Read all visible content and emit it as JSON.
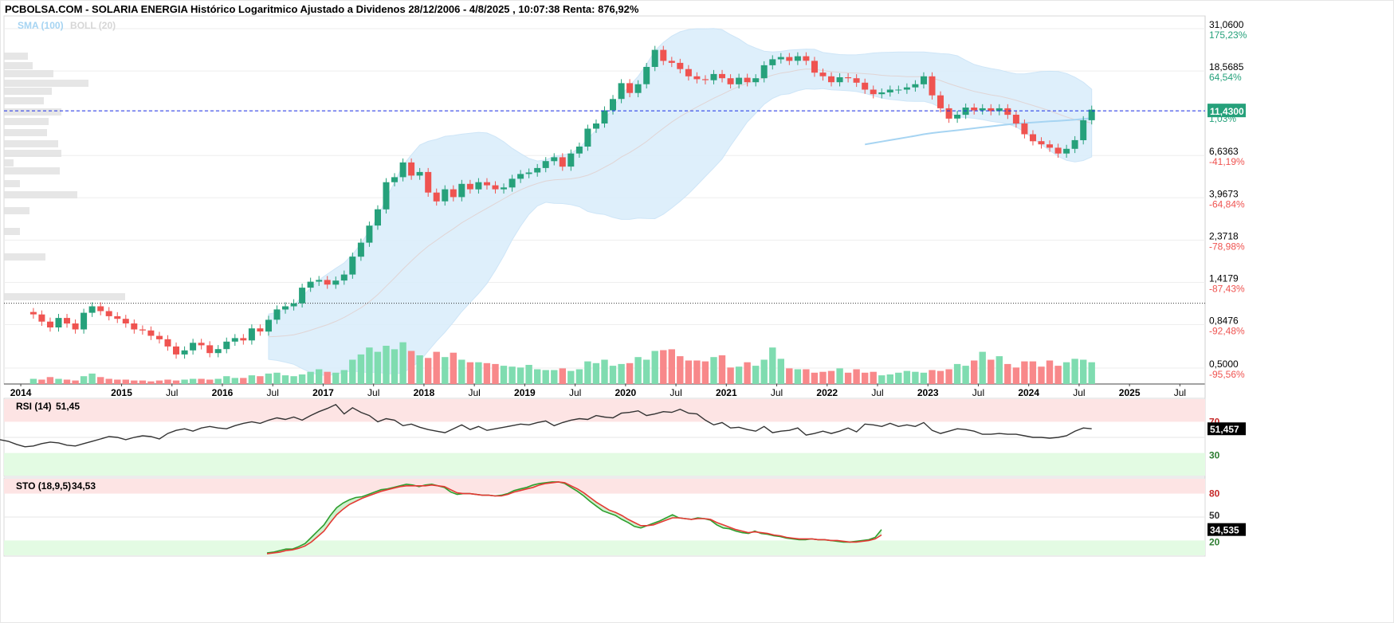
{
  "header": {
    "title": "PCBOLSA.COM - SOLARIA ENERGIA Histórico Logaritmico Ajustado a Dividenos 28/12/2006 - 4/8/2025 , 10:07:38 Renta: 876,92%",
    "legend_sma": "SMA (100)",
    "legend_boll": "BOLL (20)"
  },
  "colors": {
    "up": "#26a17b",
    "down": "#ef5350",
    "up_volume": "#7fdcb0",
    "down_volume": "#f8888a",
    "bollinger_fill": "#dbeefb",
    "sma": "#a6d4f2",
    "current_line": "#1a2ee6",
    "rsi_line": "#333333",
    "sto_k": "#2e9e2e",
    "sto_d": "#e53935",
    "overbought_band": "#fde4e4",
    "oversold_band": "#e3fbe3",
    "badge": "#26a17b",
    "badge_dark": "#000000"
  },
  "chart_data": [
    {
      "type": "candlestick",
      "name": "price",
      "scale": "log",
      "ylim": [
        0.42,
        35
      ],
      "xlim": [
        "2013-11",
        "2025-10"
      ],
      "x_ticks": [
        "2014",
        "2015",
        "Jul",
        "2016",
        "Jul",
        "2017",
        "Jul",
        "2018",
        "Jul",
        "2019",
        "Jul",
        "2020",
        "Jul",
        "2021",
        "Jul",
        "2022",
        "Jul",
        "2023",
        "Jul",
        "2024",
        "Jul",
        "2025",
        "Jul"
      ],
      "y_ticks": [
        {
          "price": "31,0600",
          "pct": "175,23%",
          "value": 31.06
        },
        {
          "price": "18,5685",
          "pct": "64,54%",
          "value": 18.5685
        },
        {
          "price": "11,4300",
          "pct": "1,03%",
          "value": 11.43
        },
        {
          "price": "6,6363",
          "pct": "-41,19%",
          "value": 6.6363
        },
        {
          "price": "3,9673",
          "pct": "-64,84%",
          "value": 3.9673
        },
        {
          "price": "2,3718",
          "pct": "-78,98%",
          "value": 2.3718
        },
        {
          "price": "1,4179",
          "pct": "-87,43%",
          "value": 1.4179
        },
        {
          "price": "0,8476",
          "pct": "-92,48%",
          "value": 0.8476
        },
        {
          "price": "0,5000",
          "pct": "-95,56%",
          "value": 0.5
        }
      ],
      "current_price": "11,4300",
      "reference_line": 1.1,
      "candles_start": "2014-02",
      "closes": [
        0.96,
        0.88,
        0.82,
        0.92,
        0.86,
        0.8,
        0.98,
        1.06,
        1.0,
        0.94,
        0.91,
        0.86,
        0.8,
        0.79,
        0.74,
        0.71,
        0.65,
        0.59,
        0.62,
        0.68,
        0.66,
        0.6,
        0.63,
        0.69,
        0.72,
        0.7,
        0.81,
        0.78,
        0.9,
        1.02,
        1.06,
        1.1,
        1.33,
        1.43,
        1.46,
        1.38,
        1.45,
        1.56,
        1.94,
        2.3,
        2.83,
        3.45,
        4.8,
        5.1,
        6.1,
        5.2,
        5.43,
        4.23,
        3.8,
        4.4,
        4.0,
        4.7,
        4.4,
        4.8,
        4.62,
        4.4,
        4.5,
        5.0,
        5.3,
        5.4,
        5.7,
        6.2,
        6.5,
        5.8,
        6.8,
        7.4,
        9.2,
        9.8,
        11.5,
        13.2,
        16.0,
        14.2,
        15.8,
        19.5,
        24.0,
        21.0,
        20.5,
        19.0,
        17.4,
        16.8,
        16.6,
        17.9,
        17.0,
        15.8,
        17.1,
        16.2,
        17.0,
        19.9,
        21.4,
        22.0,
        21.0,
        22.2,
        21.0,
        18.2,
        17.4,
        16.2,
        17.2,
        17.0,
        16.1,
        14.8,
        14.0,
        14.3,
        14.8,
        14.8,
        15.2,
        15.8,
        17.4,
        13.8,
        11.8,
        10.4,
        10.9,
        11.9,
        11.5,
        11.8,
        11.4,
        11.8,
        10.9,
        9.8,
        8.6,
        7.9,
        7.6,
        7.3,
        6.8,
        7.2,
        8.0,
        10.2,
        11.6
      ],
      "volumes": [
        6,
        5,
        8,
        6,
        5,
        4,
        9,
        12,
        8,
        6,
        5,
        5,
        4,
        4,
        3,
        4,
        5,
        4,
        5,
        6,
        6,
        5,
        6,
        9,
        7,
        7,
        10,
        9,
        12,
        13,
        10,
        9,
        11,
        14,
        17,
        14,
        13,
        16,
        28,
        34,
        42,
        37,
        44,
        40,
        48,
        38,
        33,
        30,
        37,
        31,
        36,
        28,
        25,
        25,
        24,
        23,
        21,
        20,
        19,
        22,
        17,
        16,
        16,
        18,
        15,
        17,
        26,
        24,
        28,
        21,
        23,
        24,
        31,
        28,
        38,
        39,
        40,
        32,
        27,
        27,
        26,
        31,
        33,
        19,
        20,
        25,
        21,
        28,
        42,
        29,
        18,
        17,
        17,
        13,
        14,
        15,
        18,
        13,
        17,
        13,
        14,
        10,
        11,
        13,
        15,
        14,
        13,
        16,
        15,
        17,
        23,
        21,
        27,
        37,
        28,
        32,
        23,
        19,
        26,
        26,
        20,
        27,
        21,
        25,
        29,
        28,
        25,
        40,
        66,
        40
      ]
    },
    {
      "type": "line",
      "name": "RSI (14)",
      "label": "RSI (14)",
      "value_text": "51,45",
      "badge": "51,457",
      "ylim": [
        0,
        100
      ],
      "levels": [
        "70",
        "30"
      ],
      "values": [
        47,
        45,
        41,
        38,
        39,
        42,
        44,
        43,
        40,
        39,
        42,
        45,
        48,
        51,
        50,
        47,
        50,
        52,
        51,
        48,
        55,
        59,
        61,
        58,
        62,
        64,
        62,
        61,
        65,
        68,
        70,
        68,
        72,
        75,
        73,
        76,
        72,
        78,
        83,
        87,
        92,
        80,
        88,
        82,
        78,
        70,
        74,
        72,
        65,
        67,
        63,
        60,
        58,
        56,
        61,
        66,
        60,
        64,
        59,
        61,
        63,
        65,
        67,
        66,
        69,
        71,
        65,
        69,
        72,
        74,
        73,
        78,
        76,
        75,
        81,
        82,
        84,
        78,
        80,
        83,
        82,
        86,
        81,
        80,
        72,
        66,
        69,
        62,
        63,
        60,
        58,
        64,
        56,
        58,
        59,
        62,
        53,
        55,
        58,
        55,
        58,
        62,
        57,
        67,
        66,
        64,
        68,
        64,
        66,
        64,
        69,
        59,
        55,
        58,
        61,
        60,
        58,
        54,
        54,
        55,
        54,
        54,
        52,
        50,
        50,
        49,
        50,
        52,
        58,
        62,
        61
      ]
    },
    {
      "type": "line",
      "name": "STO (18,9,5)",
      "label": "STO (18,9,5)",
      "value_text": "34,53",
      "badge": "34,535",
      "ylim": [
        0,
        100
      ],
      "levels": [
        "80",
        "50",
        "20"
      ],
      "k_values": [
        4,
        5,
        7,
        9,
        9,
        12,
        16,
        24,
        32,
        40,
        52,
        62,
        68,
        72,
        75,
        76,
        79,
        82,
        85,
        86,
        88,
        90,
        92,
        91,
        89,
        91,
        92,
        90,
        88,
        82,
        79,
        80,
        80,
        79,
        78,
        78,
        77,
        78,
        80,
        84,
        86,
        88,
        91,
        93,
        94,
        95,
        95,
        93,
        88,
        83,
        77,
        70,
        64,
        58,
        55,
        52,
        47,
        43,
        38,
        36,
        39,
        42,
        45,
        49,
        53,
        49,
        48,
        47,
        49,
        48,
        46,
        40,
        36,
        35,
        32,
        30,
        29,
        32,
        29,
        28,
        26,
        25,
        23,
        22,
        21,
        21,
        22,
        21,
        21,
        20,
        19,
        18,
        18,
        19,
        20,
        21,
        24,
        34
      ],
      "d_values": [
        3,
        4,
        5,
        7,
        8,
        10,
        13,
        18,
        25,
        32,
        43,
        53,
        60,
        66,
        70,
        74,
        77,
        80,
        83,
        85,
        87,
        89,
        90,
        90,
        90,
        90,
        91,
        90,
        89,
        85,
        81,
        80,
        80,
        79,
        78,
        78,
        77,
        77,
        79,
        82,
        84,
        86,
        88,
        91,
        93,
        94,
        95,
        94,
        90,
        86,
        81,
        75,
        69,
        64,
        59,
        56,
        52,
        47,
        43,
        39,
        39,
        40,
        43,
        46,
        49,
        49,
        48,
        47,
        48,
        48,
        47,
        43,
        40,
        37,
        34,
        32,
        30,
        31,
        30,
        29,
        27,
        26,
        24,
        23,
        22,
        22,
        22,
        21,
        21,
        20,
        20,
        19,
        18,
        18,
        19,
        20,
        22,
        27
      ]
    }
  ]
}
